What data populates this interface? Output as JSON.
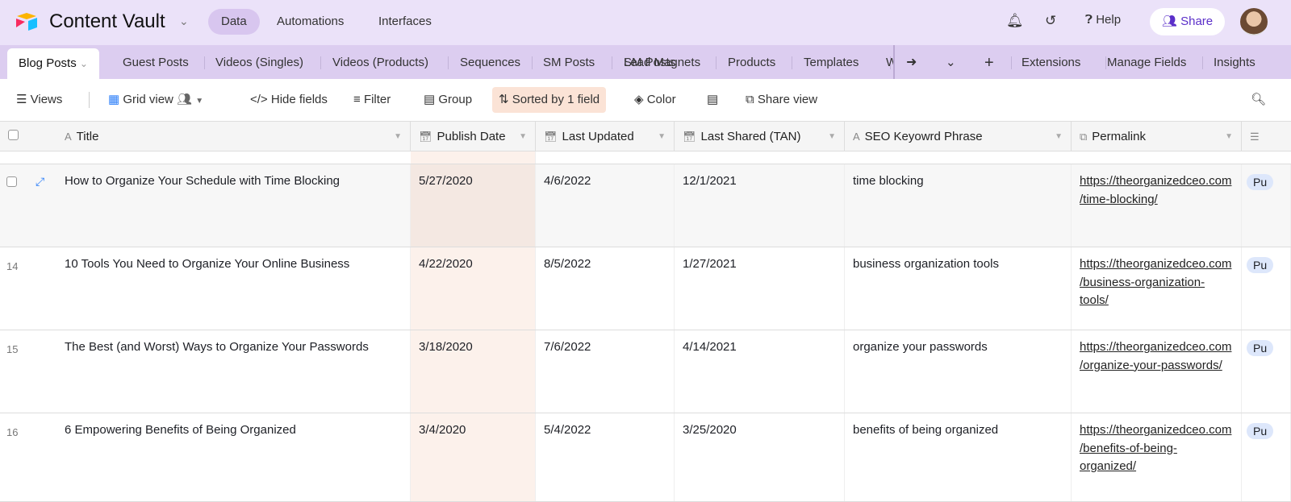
{
  "topbar": {
    "title": "Content Vault",
    "nav": [
      "Data",
      "Automations",
      "Interfaces"
    ],
    "help": "Help",
    "share": "Share"
  },
  "tabs": {
    "items": [
      "Blog Posts",
      "Guest Posts",
      "Videos (Singles)",
      "Videos (Products)",
      "Sequences",
      "SM Posts",
      "Lead Magnets",
      "Products",
      "Templates",
      "W"
    ],
    "right": [
      "Extensions",
      "Manage Fields",
      "Insights"
    ]
  },
  "toolbar": {
    "views": "Views",
    "grid_view": "Grid view",
    "hide_fields": "Hide fields",
    "filter": "Filter",
    "group": "Group",
    "sorted": "Sorted by 1 field",
    "color": "Color",
    "share_view": "Share view"
  },
  "columns": [
    "Title",
    "Publish Date",
    "Last Updated",
    "Last Shared (TAN)",
    "SEO Keyowrd Phrase",
    "Permalink"
  ],
  "rows": [
    {
      "num": "",
      "title": "How to Organize Your Schedule with Time Blocking",
      "publish": "5/27/2020",
      "updated": "4/6/2022",
      "shared": "12/1/2021",
      "seo": "time blocking",
      "permalink": "https://theorganizedceo.com/time-blocking/",
      "status": "Pu"
    },
    {
      "num": "14",
      "title": "10 Tools You Need to Organize Your Online Business",
      "publish": "4/22/2020",
      "updated": "8/5/2022",
      "shared": "1/27/2021",
      "seo": "business organization tools",
      "permalink": "https://theorganizedceo.com/business-organization-tools/",
      "status": "Pu"
    },
    {
      "num": "15",
      "title": "The Best (and Worst) Ways to Organize Your Passwords",
      "publish": "3/18/2020",
      "updated": "7/6/2022",
      "shared": "4/14/2021",
      "seo": "organize your passwords",
      "permalink": "https://theorganizedceo.com/organize-your-passwords/",
      "status": "Pu"
    },
    {
      "num": "16",
      "title": "6 Empowering Benefits of Being Organized",
      "publish": "3/4/2020",
      "updated": "5/4/2022",
      "shared": "3/25/2020",
      "seo": "benefits of being organized",
      "permalink": "https://theorganizedceo.com/benefits-of-being-organized/",
      "status": "Pu"
    }
  ],
  "colors": {
    "topbar": "#ebe2f9",
    "tabbar": "#dccdf0",
    "share_text": "#5b2fc9",
    "sorted_bg": "#fbe3d6",
    "accent": "#2d7ff9"
  }
}
